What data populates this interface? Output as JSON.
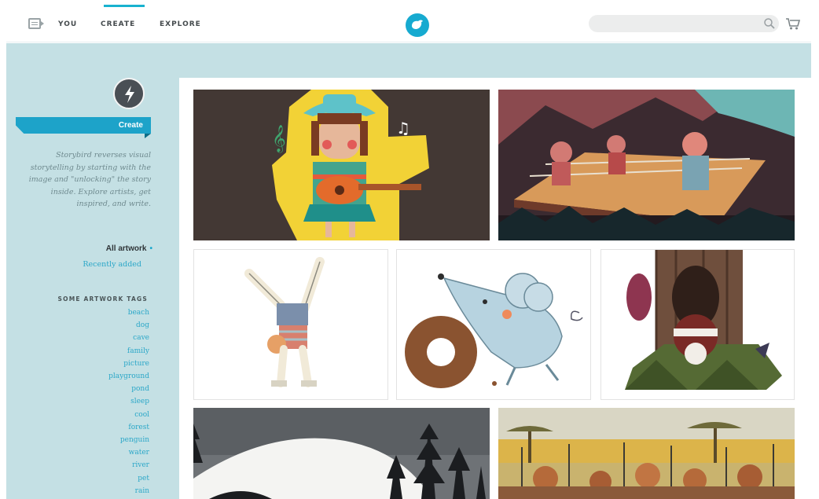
{
  "header": {
    "nav": {
      "you": "YOU",
      "create": "CREATE",
      "explore": "EXPLORE"
    },
    "active_nav": "create",
    "search": {
      "placeholder": "",
      "value": ""
    },
    "icons": [
      "menu-icon",
      "bird-logo-icon",
      "search-icon",
      "cart-icon"
    ],
    "accent_color": "#18b2cf"
  },
  "sidebar": {
    "create_label": "Create",
    "tagline": "Storybird reverses visual storytelling by starting with the image and \"unlocking\" the story inside. Explore artists, get inspired, and write.",
    "filters": {
      "all_artwork": "All artwork",
      "recently_added": "Recently added"
    },
    "tags_heading": "SOME ARTWORK TAGS",
    "tags": [
      "beach",
      "dog",
      "cave",
      "family",
      "picture",
      "playground",
      "pond",
      "sleep",
      "cool",
      "forest",
      "penguin",
      "water",
      "river",
      "pet",
      "rain"
    ],
    "background_color": "#c4e0e4",
    "link_color": "#2ba7c8"
  },
  "gallery": {
    "artworks": [
      {
        "subject": "Girl with guitar and cowboy hat"
      },
      {
        "subject": "Wrestlers in a boxing ring"
      },
      {
        "subject": "Child doing a cartwheel"
      },
      {
        "subject": "Mouse pushing a donut"
      },
      {
        "subject": "Creature in a tree stump"
      },
      {
        "subject": "Dark forest with snowy mountain"
      },
      {
        "subject": "Savanna village crowd"
      }
    ]
  }
}
